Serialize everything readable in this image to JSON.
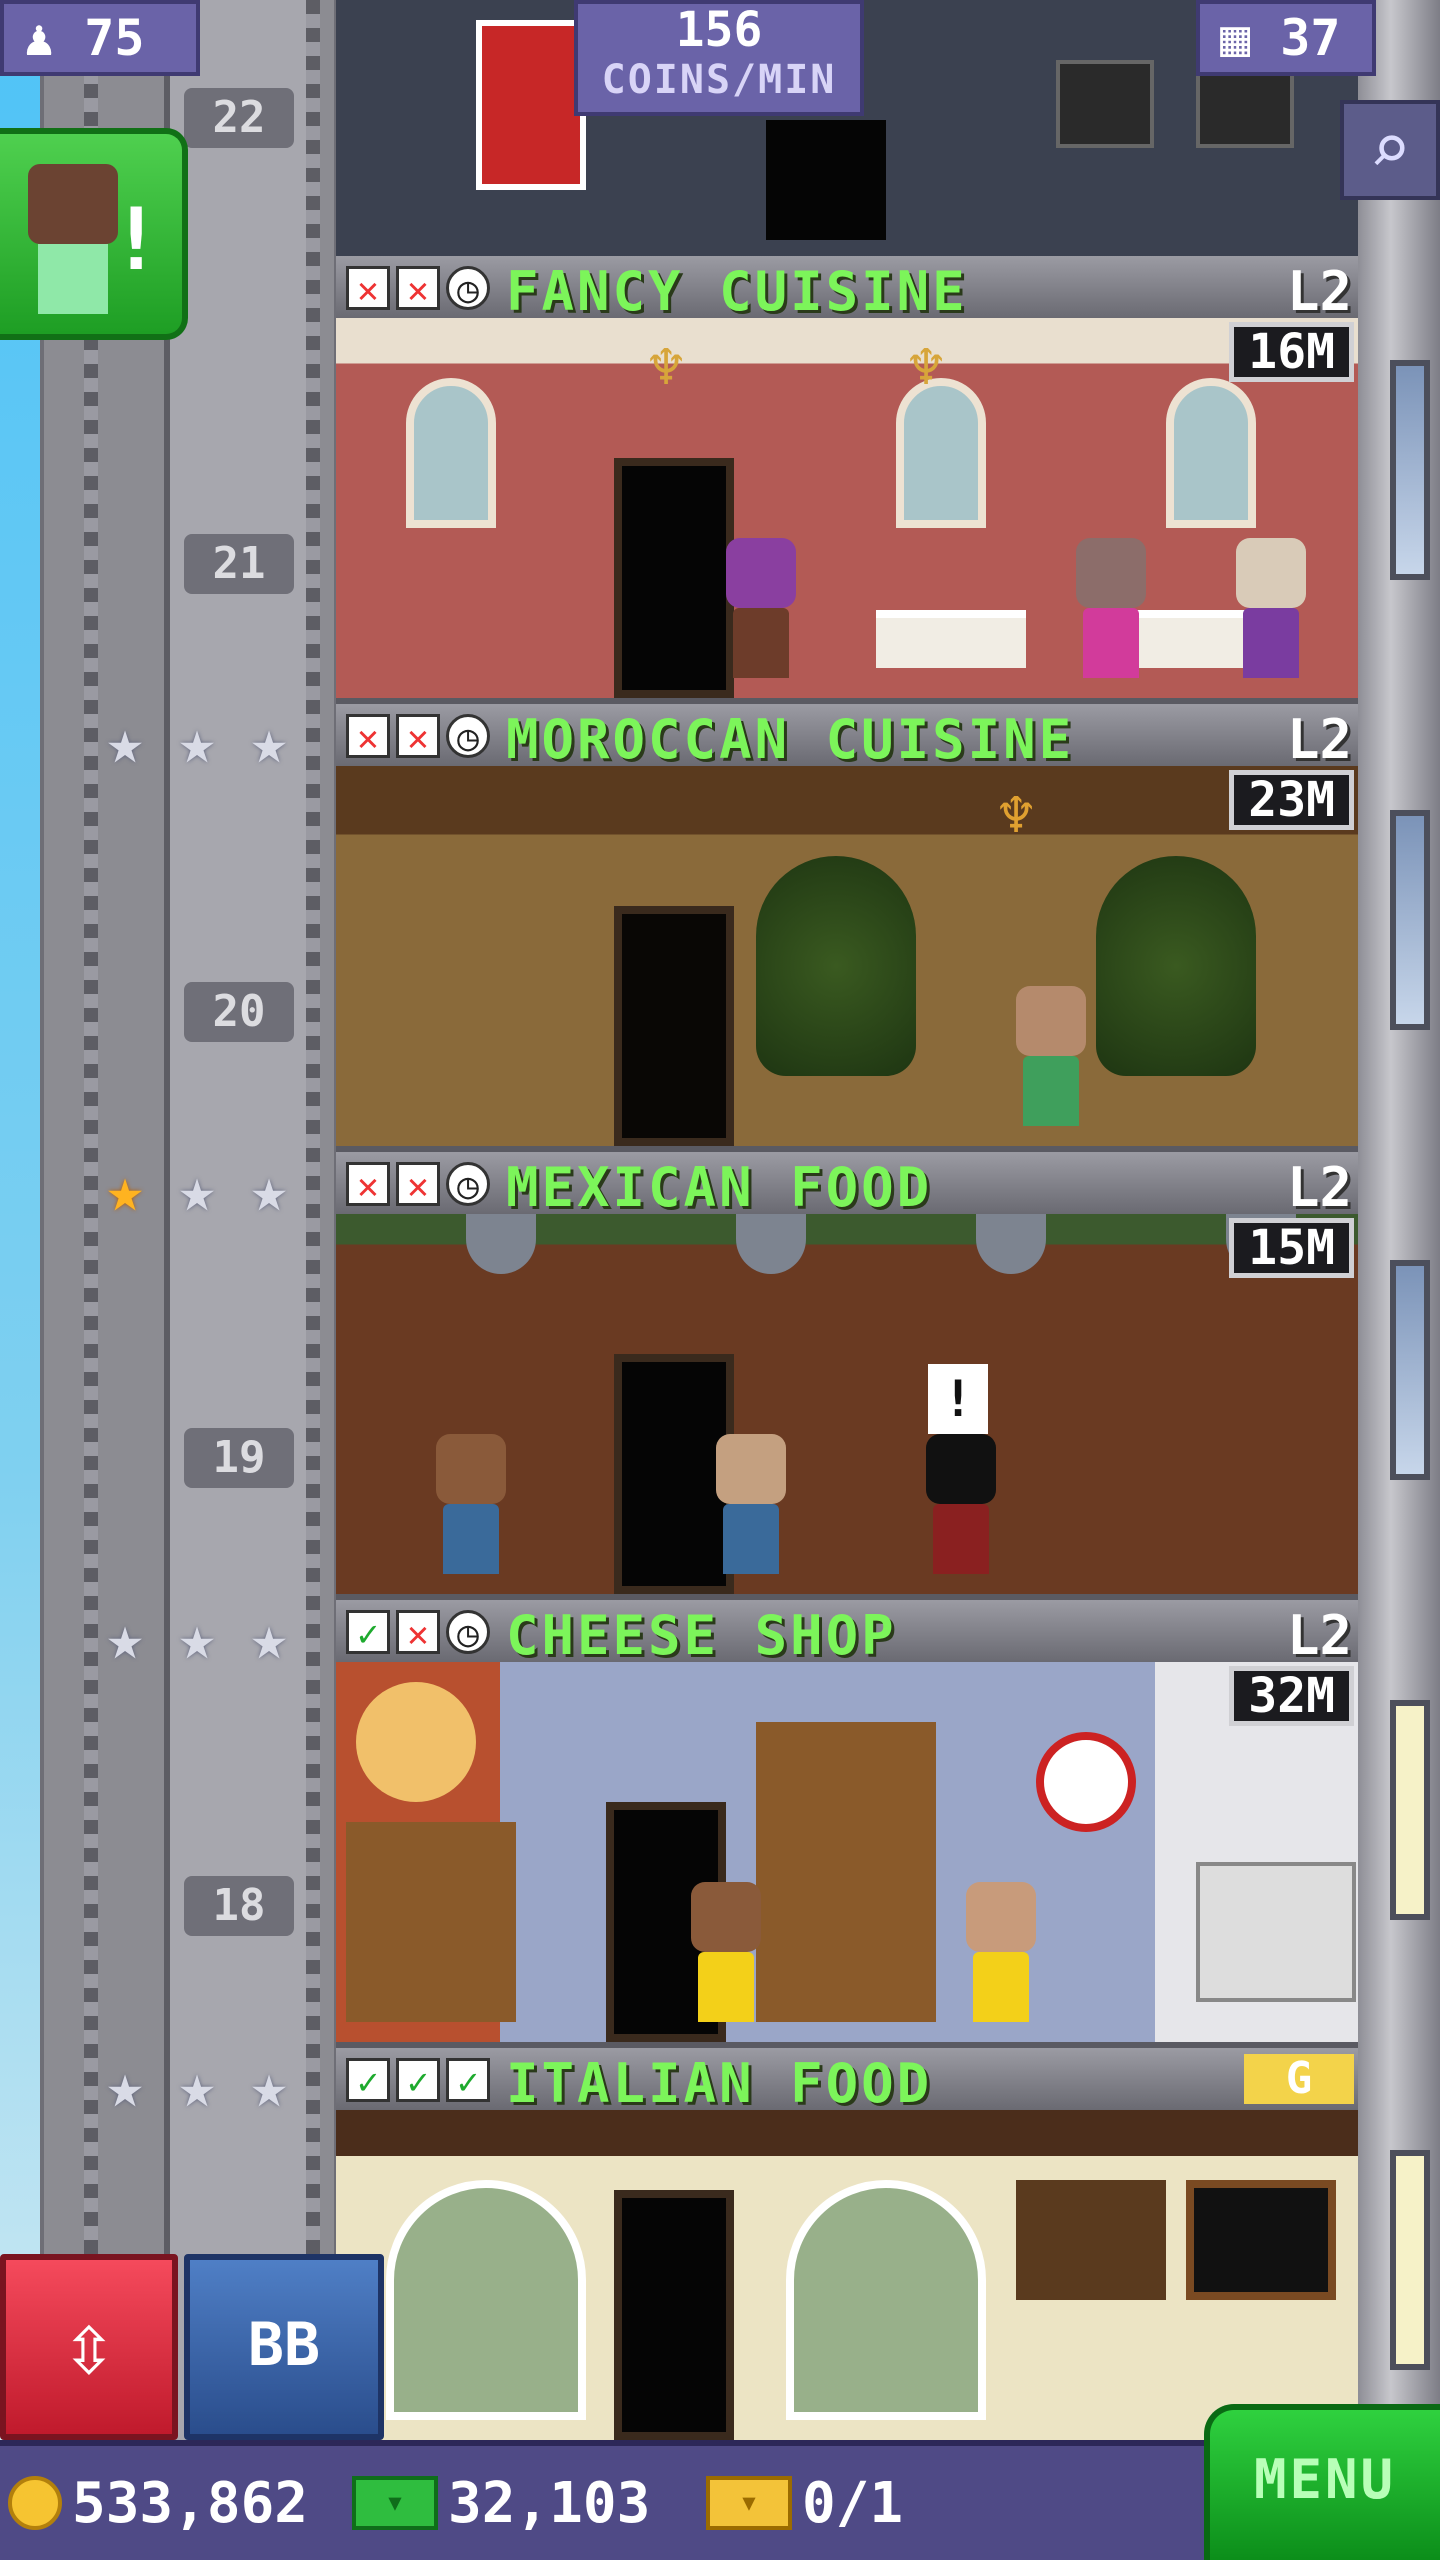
{
  "hud": {
    "population": "75",
    "coins_per_min_value": "156",
    "coins_per_min_unit": "COINS/MIN",
    "floors_count": "37"
  },
  "elevator": {
    "floor_numbers": [
      "22",
      "21",
      "20",
      "19",
      "18"
    ]
  },
  "floors": [
    {
      "name": "FANCY CUISINE",
      "level": "L2",
      "stock": "16M",
      "status": [
        "no",
        "no",
        "clock"
      ]
    },
    {
      "name": "MOROCCAN CUISINE",
      "level": "L2",
      "stock": "23M",
      "status": [
        "no",
        "no",
        "clock"
      ]
    },
    {
      "name": "MEXICAN FOOD",
      "level": "L2",
      "stock": "15M",
      "status": [
        "no",
        "no",
        "clock"
      ]
    },
    {
      "name": "CHEESE SHOP",
      "level": "L2",
      "stock": "32M",
      "status": [
        "yes",
        "no",
        "clock"
      ]
    },
    {
      "name": "ITALIAN FOOD",
      "level": "G",
      "stock": "",
      "status": [
        "yes",
        "yes",
        "yes"
      ]
    }
  ],
  "controls": {
    "bitbook_label": "BB",
    "menu_label": "MENU"
  },
  "bottom_bar": {
    "coins": "533,862",
    "bux": "32,103",
    "tickets": "0/1"
  },
  "icons": {
    "population": "person-icon",
    "floors": "building-icon",
    "search": "magnifier-icon",
    "coin": "coin-icon",
    "bux": "bux-icon",
    "ticket": "ticket-icon",
    "elevator": "up-down-arrows-icon"
  },
  "colors": {
    "floor_name": "#7cf55a",
    "hud_panel": "#6a63a8",
    "menu_button": "#2fd13f",
    "elevator_button": "#f54a5c",
    "bitbook_button": "#4f7fc6"
  }
}
